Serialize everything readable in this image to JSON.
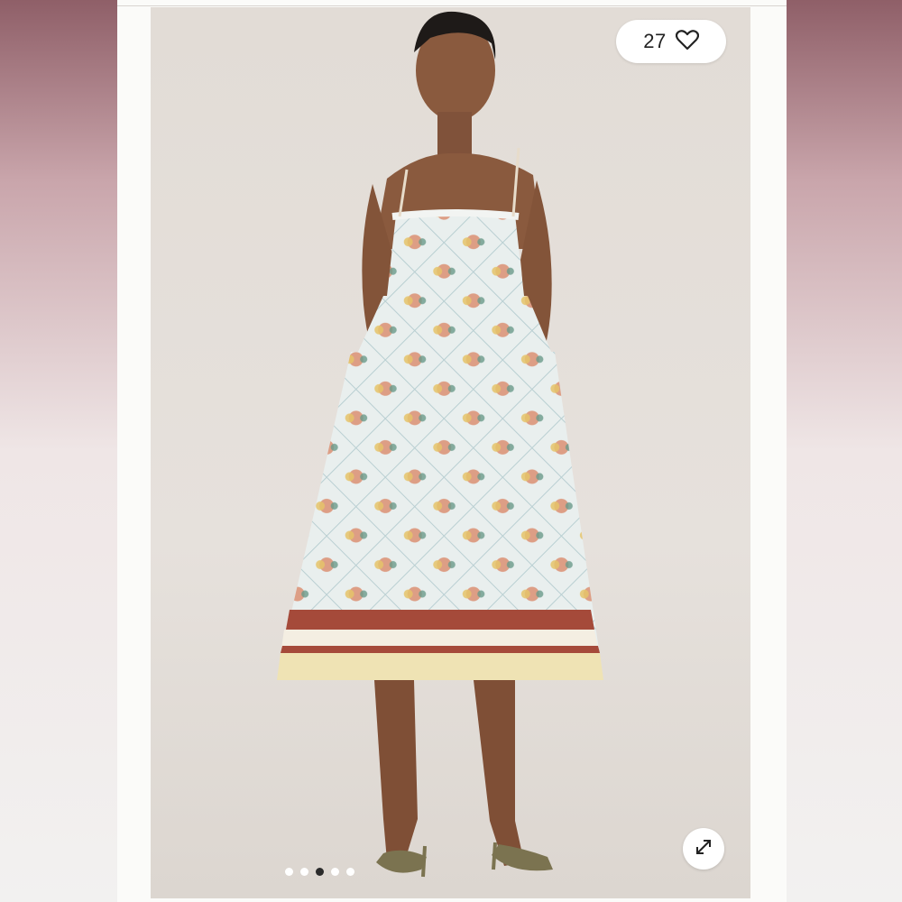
{
  "listing": {
    "like_count": "27",
    "like_icon": "heart-icon",
    "expand_icon": "expand-icon",
    "carousel": {
      "total": 5,
      "active_index": 2
    }
  },
  "colors": {
    "dress_base": "#e9efee",
    "dress_border_cream": "#efe3b4",
    "dress_border_rust": "#a54a3a",
    "skin": "#8a5a3e",
    "sandal": "#7b7350"
  }
}
